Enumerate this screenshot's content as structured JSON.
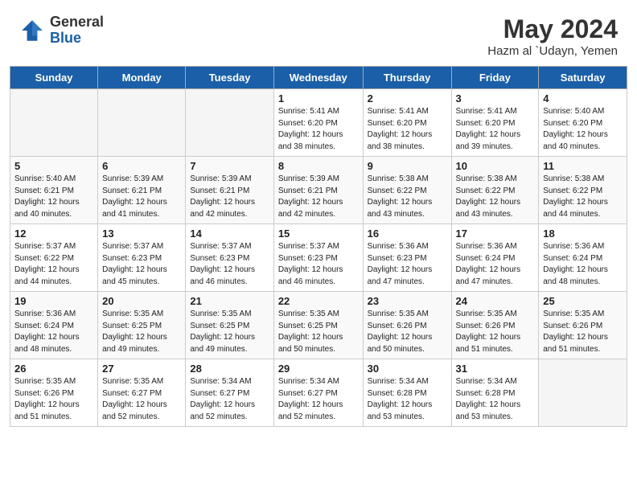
{
  "header": {
    "logo_general": "General",
    "logo_blue": "Blue",
    "month_year": "May 2024",
    "location": "Hazm al `Udayn, Yemen"
  },
  "days_of_week": [
    "Sunday",
    "Monday",
    "Tuesday",
    "Wednesday",
    "Thursday",
    "Friday",
    "Saturday"
  ],
  "weeks": [
    [
      {
        "day": "",
        "info": ""
      },
      {
        "day": "",
        "info": ""
      },
      {
        "day": "",
        "info": ""
      },
      {
        "day": "1",
        "info": "Sunrise: 5:41 AM\nSunset: 6:20 PM\nDaylight: 12 hours\nand 38 minutes."
      },
      {
        "day": "2",
        "info": "Sunrise: 5:41 AM\nSunset: 6:20 PM\nDaylight: 12 hours\nand 38 minutes."
      },
      {
        "day": "3",
        "info": "Sunrise: 5:41 AM\nSunset: 6:20 PM\nDaylight: 12 hours\nand 39 minutes."
      },
      {
        "day": "4",
        "info": "Sunrise: 5:40 AM\nSunset: 6:20 PM\nDaylight: 12 hours\nand 40 minutes."
      }
    ],
    [
      {
        "day": "5",
        "info": "Sunrise: 5:40 AM\nSunset: 6:21 PM\nDaylight: 12 hours\nand 40 minutes."
      },
      {
        "day": "6",
        "info": "Sunrise: 5:39 AM\nSunset: 6:21 PM\nDaylight: 12 hours\nand 41 minutes."
      },
      {
        "day": "7",
        "info": "Sunrise: 5:39 AM\nSunset: 6:21 PM\nDaylight: 12 hours\nand 42 minutes."
      },
      {
        "day": "8",
        "info": "Sunrise: 5:39 AM\nSunset: 6:21 PM\nDaylight: 12 hours\nand 42 minutes."
      },
      {
        "day": "9",
        "info": "Sunrise: 5:38 AM\nSunset: 6:22 PM\nDaylight: 12 hours\nand 43 minutes."
      },
      {
        "day": "10",
        "info": "Sunrise: 5:38 AM\nSunset: 6:22 PM\nDaylight: 12 hours\nand 43 minutes."
      },
      {
        "day": "11",
        "info": "Sunrise: 5:38 AM\nSunset: 6:22 PM\nDaylight: 12 hours\nand 44 minutes."
      }
    ],
    [
      {
        "day": "12",
        "info": "Sunrise: 5:37 AM\nSunset: 6:22 PM\nDaylight: 12 hours\nand 44 minutes."
      },
      {
        "day": "13",
        "info": "Sunrise: 5:37 AM\nSunset: 6:23 PM\nDaylight: 12 hours\nand 45 minutes."
      },
      {
        "day": "14",
        "info": "Sunrise: 5:37 AM\nSunset: 6:23 PM\nDaylight: 12 hours\nand 46 minutes."
      },
      {
        "day": "15",
        "info": "Sunrise: 5:37 AM\nSunset: 6:23 PM\nDaylight: 12 hours\nand 46 minutes."
      },
      {
        "day": "16",
        "info": "Sunrise: 5:36 AM\nSunset: 6:23 PM\nDaylight: 12 hours\nand 47 minutes."
      },
      {
        "day": "17",
        "info": "Sunrise: 5:36 AM\nSunset: 6:24 PM\nDaylight: 12 hours\nand 47 minutes."
      },
      {
        "day": "18",
        "info": "Sunrise: 5:36 AM\nSunset: 6:24 PM\nDaylight: 12 hours\nand 48 minutes."
      }
    ],
    [
      {
        "day": "19",
        "info": "Sunrise: 5:36 AM\nSunset: 6:24 PM\nDaylight: 12 hours\nand 48 minutes."
      },
      {
        "day": "20",
        "info": "Sunrise: 5:35 AM\nSunset: 6:25 PM\nDaylight: 12 hours\nand 49 minutes."
      },
      {
        "day": "21",
        "info": "Sunrise: 5:35 AM\nSunset: 6:25 PM\nDaylight: 12 hours\nand 49 minutes."
      },
      {
        "day": "22",
        "info": "Sunrise: 5:35 AM\nSunset: 6:25 PM\nDaylight: 12 hours\nand 50 minutes."
      },
      {
        "day": "23",
        "info": "Sunrise: 5:35 AM\nSunset: 6:26 PM\nDaylight: 12 hours\nand 50 minutes."
      },
      {
        "day": "24",
        "info": "Sunrise: 5:35 AM\nSunset: 6:26 PM\nDaylight: 12 hours\nand 51 minutes."
      },
      {
        "day": "25",
        "info": "Sunrise: 5:35 AM\nSunset: 6:26 PM\nDaylight: 12 hours\nand 51 minutes."
      }
    ],
    [
      {
        "day": "26",
        "info": "Sunrise: 5:35 AM\nSunset: 6:26 PM\nDaylight: 12 hours\nand 51 minutes."
      },
      {
        "day": "27",
        "info": "Sunrise: 5:35 AM\nSunset: 6:27 PM\nDaylight: 12 hours\nand 52 minutes."
      },
      {
        "day": "28",
        "info": "Sunrise: 5:34 AM\nSunset: 6:27 PM\nDaylight: 12 hours\nand 52 minutes."
      },
      {
        "day": "29",
        "info": "Sunrise: 5:34 AM\nSunset: 6:27 PM\nDaylight: 12 hours\nand 52 minutes."
      },
      {
        "day": "30",
        "info": "Sunrise: 5:34 AM\nSunset: 6:28 PM\nDaylight: 12 hours\nand 53 minutes."
      },
      {
        "day": "31",
        "info": "Sunrise: 5:34 AM\nSunset: 6:28 PM\nDaylight: 12 hours\nand 53 minutes."
      },
      {
        "day": "",
        "info": ""
      }
    ]
  ]
}
